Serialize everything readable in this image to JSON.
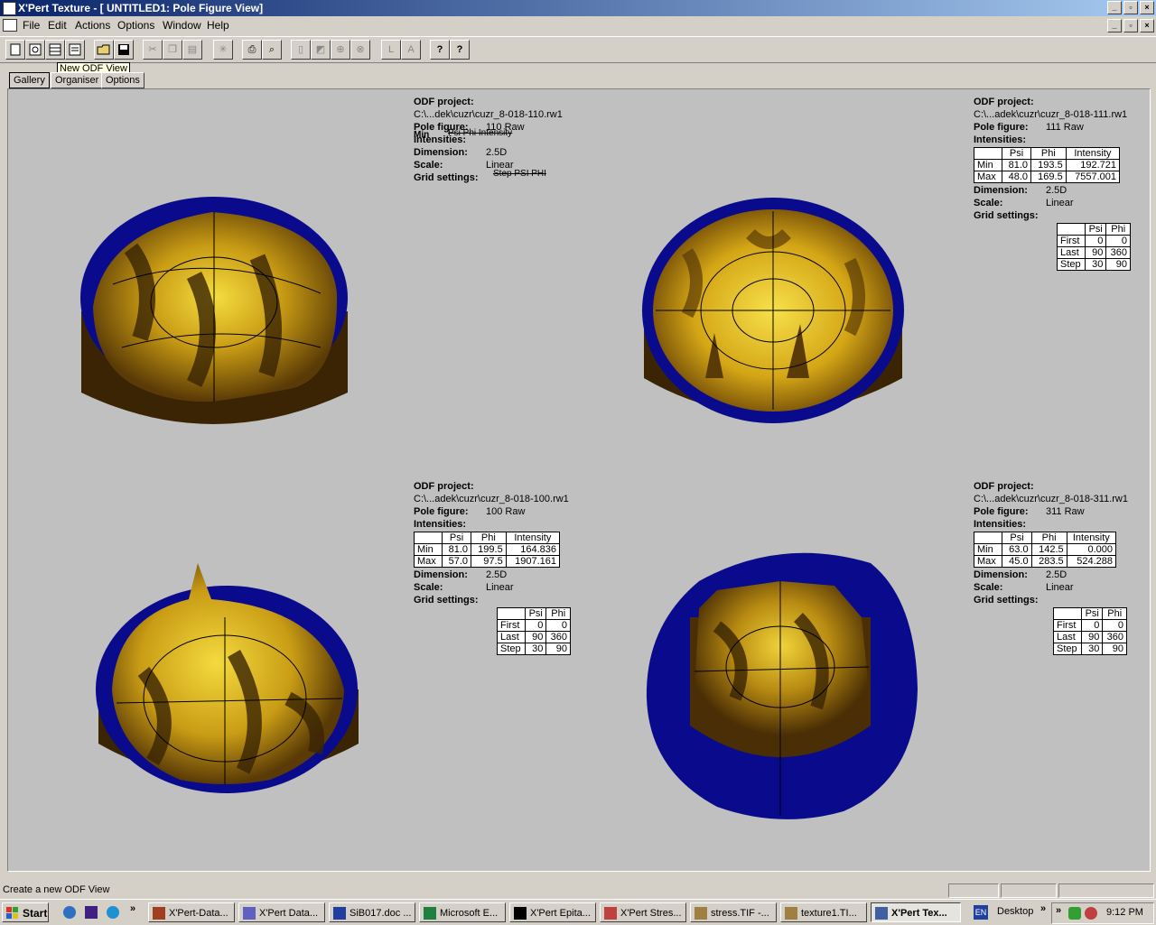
{
  "window": {
    "title": "X'Pert Texture - [ UNTITLED1: Pole Figure View]",
    "btn_min": "_",
    "btn_max": "▫",
    "btn_close": "×"
  },
  "menu": [
    "File",
    "Edit",
    "Actions",
    "Options",
    "Window",
    "Help"
  ],
  "toolbar": {
    "tooltip": "New ODF View",
    "help_glyph": "?",
    "context_help_glyph": "?",
    "label_l": "L",
    "label_a": "A"
  },
  "tabs": [
    "Gallery",
    "Organiser",
    "Options"
  ],
  "labels": {
    "odf_project": "ODF project:",
    "pole_figure": "Pole figure:",
    "intensities": "Intensities:",
    "dimension": "Dimension:",
    "scale": "Scale:",
    "grid_settings": "Grid settings:",
    "col_psi": "Psi",
    "col_phi": "Phi",
    "col_intensity": "Intensity",
    "row_min": "Min",
    "row_max": "Max",
    "row_first": "First",
    "row_last": "Last",
    "row_step": "Step"
  },
  "figures": [
    {
      "project": "C:\\...dek\\cuzr\\cuzr_8-018-110.rw1",
      "pole": "110 Raw",
      "dimension": "2.5D",
      "scale": "Linear",
      "garbled_intensity": "Psi     Phi     Intensity",
      "garbled_min": "Min",
      "garbled_grid": "Step    PSI    PHI"
    },
    {
      "project": "C:\\...adek\\cuzr\\cuzr_8-018-111.rw1",
      "pole": "111 Raw",
      "dimension": "2.5D",
      "scale": "Linear",
      "min": [
        "81.0",
        "193.5",
        "192.721"
      ],
      "max": [
        "48.0",
        "169.5",
        "7557.001"
      ],
      "grid": {
        "first": [
          "0",
          "0"
        ],
        "last": [
          "90",
          "360"
        ],
        "step": [
          "30",
          "90"
        ]
      }
    },
    {
      "project": "C:\\...adek\\cuzr\\cuzr_8-018-100.rw1",
      "pole": "100 Raw",
      "dimension": "2.5D",
      "scale": "Linear",
      "min": [
        "81.0",
        "199.5",
        "164.836"
      ],
      "max": [
        "57.0",
        "97.5",
        "1907.161"
      ],
      "grid": {
        "first": [
          "0",
          "0"
        ],
        "last": [
          "90",
          "360"
        ],
        "step": [
          "30",
          "90"
        ]
      }
    },
    {
      "project": "C:\\...adek\\cuzr\\cuzr_8-018-311.rw1",
      "pole": "311 Raw",
      "dimension": "2.5D",
      "scale": "Linear",
      "min": [
        "63.0",
        "142.5",
        "0.000"
      ],
      "max": [
        "45.0",
        "283.5",
        "524.288"
      ],
      "grid": {
        "first": [
          "0",
          "0"
        ],
        "last": [
          "90",
          "360"
        ],
        "step": [
          "30",
          "90"
        ]
      }
    }
  ],
  "colors": {
    "gold": "#e6c21a",
    "dark": "#3a2404",
    "rim": "#0a0a8c",
    "bg": "#c0c0c0"
  },
  "status": {
    "text": "Create a new ODF View"
  },
  "taskbar": {
    "start": "Start",
    "chevron": "»",
    "tasks": [
      "X'Pert-Data...",
      "X'Pert Data...",
      "SiB017.doc ...",
      "Microsoft E...",
      "X'Pert Epita...",
      "X'Pert Stres...",
      "stress.TIF -...",
      "texture1.TI...",
      "X'Pert Tex..."
    ],
    "lang": "EN",
    "desktop": "Desktop",
    "clock": "9:12 PM"
  }
}
